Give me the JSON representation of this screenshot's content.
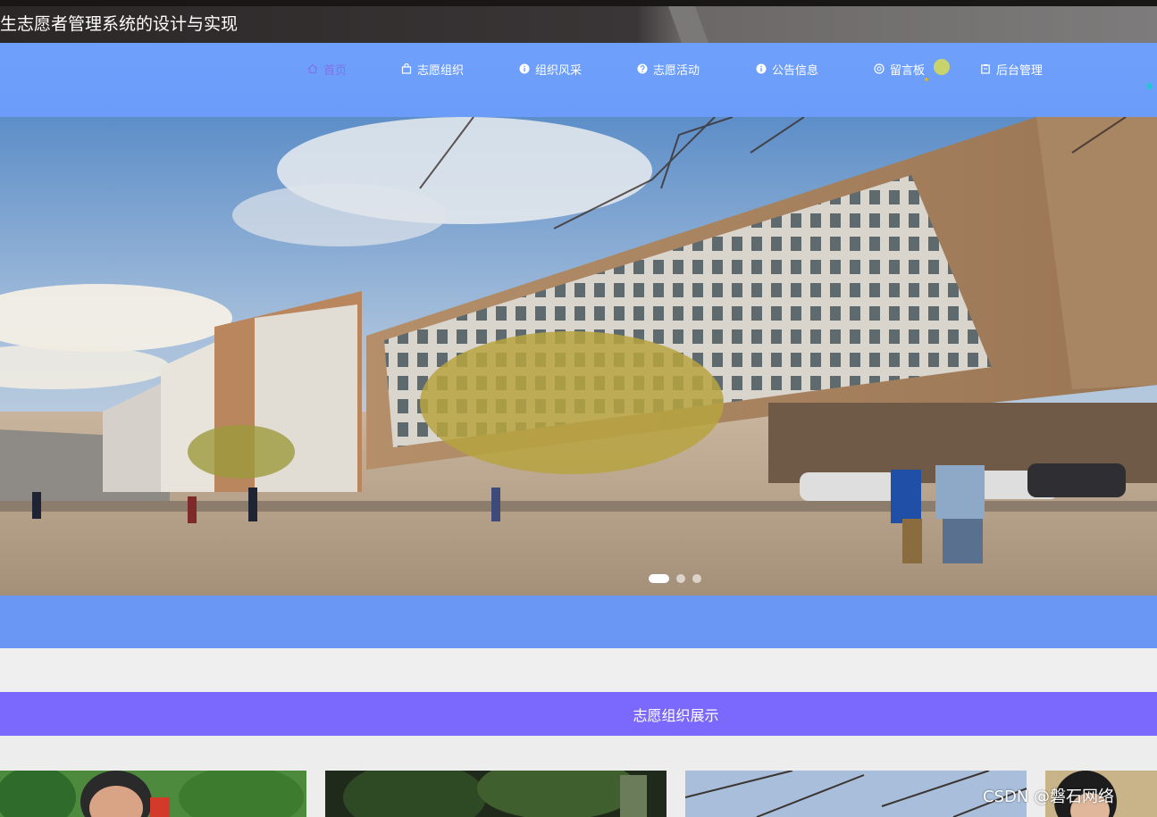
{
  "header": {
    "title": "生志愿者管理系统的设计与实现"
  },
  "nav": {
    "items": [
      {
        "label": "首页",
        "icon": "home-icon",
        "active": true
      },
      {
        "label": "志愿组织",
        "icon": "bag-icon",
        "active": false
      },
      {
        "label": "组织风采",
        "icon": "info-icon",
        "active": false
      },
      {
        "label": "志愿活动",
        "icon": "question-icon",
        "active": false
      },
      {
        "label": "公告信息",
        "icon": "info-icon",
        "active": false
      },
      {
        "label": "留言板",
        "icon": "chat-icon",
        "active": false
      },
      {
        "label": "后台管理",
        "icon": "clipboard-icon",
        "active": false
      }
    ]
  },
  "carousel": {
    "slide_count": 3,
    "active_index": 0
  },
  "section": {
    "title": "志愿组织展示"
  },
  "watermark": "CSDN @磐石网络",
  "colors": {
    "nav_bg": "#6ea0fb",
    "nav_active": "#7f73e6",
    "band_blue": "#6b97f4",
    "section_bar": "#7a69fc",
    "title_bar": "#2b2727"
  }
}
